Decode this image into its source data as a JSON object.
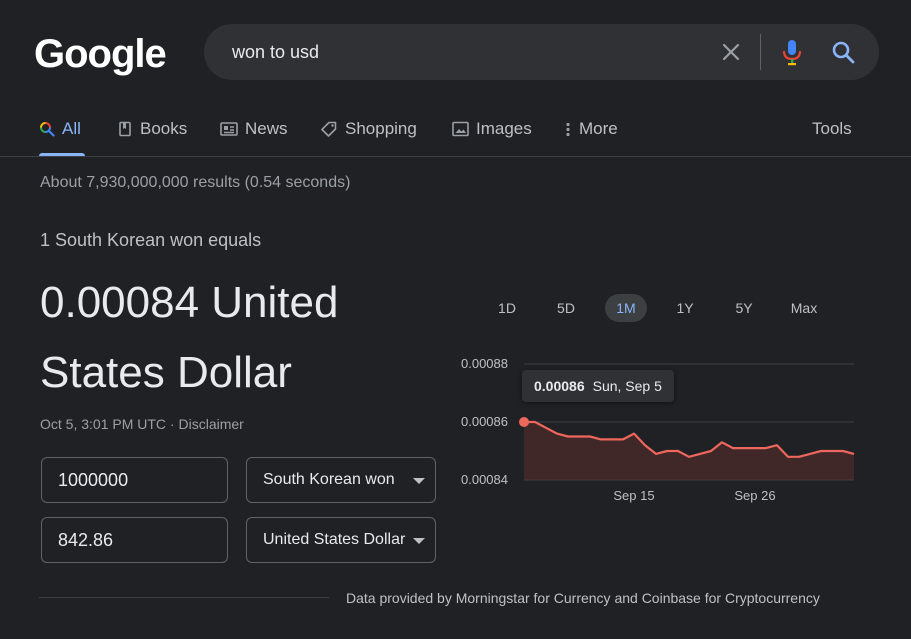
{
  "header": {
    "logo_text": "Google",
    "search": {
      "value": "won to usd",
      "clear_icon": "close-icon",
      "mic_icon": "microphone-icon",
      "search_icon": "search-icon"
    }
  },
  "tabs": [
    {
      "label": "All",
      "icon": "search-multicolor-icon",
      "active": true
    },
    {
      "label": "Books",
      "icon": "book-icon",
      "active": false
    },
    {
      "label": "News",
      "icon": "newspaper-icon",
      "active": false
    },
    {
      "label": "Shopping",
      "icon": "tag-icon",
      "active": false
    },
    {
      "label": "Images",
      "icon": "image-icon",
      "active": false
    },
    {
      "label": "More",
      "icon": "more-vert-icon",
      "active": false
    }
  ],
  "tools_label": "Tools",
  "result_stats": "About 7,930,000,000 results (0.54 seconds)",
  "converter": {
    "equals_label": "1 South Korean won equals",
    "result_value": "0.00084 United States Dollar",
    "timestamp": "Oct 5, 3:01 PM UTC",
    "separator": " · ",
    "disclaimer": "Disclaimer",
    "from_amount": "1000000",
    "from_currency": "South Korean won",
    "to_amount": "842.86",
    "to_currency": "United States Dollar"
  },
  "chart_controls": {
    "ranges": [
      "1D",
      "5D",
      "1M",
      "1Y",
      "5Y",
      "Max"
    ],
    "active": "1M"
  },
  "tooltip": {
    "value": "0.00086",
    "date": "Sun, Sep 5"
  },
  "chart_data": {
    "type": "area",
    "x": [
      "Sep 5",
      "Sep 6",
      "Sep 7",
      "Sep 8",
      "Sep 9",
      "Sep 10",
      "Sep 11",
      "Sep 12",
      "Sep 13",
      "Sep 14",
      "Sep 15",
      "Sep 16",
      "Sep 17",
      "Sep 18",
      "Sep 19",
      "Sep 20",
      "Sep 21",
      "Sep 22",
      "Sep 23",
      "Sep 24",
      "Sep 25",
      "Sep 26",
      "Sep 27",
      "Sep 28",
      "Sep 29",
      "Sep 30",
      "Oct 1",
      "Oct 2",
      "Oct 3",
      "Oct 4",
      "Oct 5"
    ],
    "values": [
      0.00086,
      0.00086,
      0.000858,
      0.000856,
      0.000855,
      0.000855,
      0.000855,
      0.000854,
      0.000854,
      0.000854,
      0.000856,
      0.000852,
      0.000849,
      0.00085,
      0.00085,
      0.000848,
      0.000849,
      0.00085,
      0.000853,
      0.000851,
      0.000851,
      0.000851,
      0.000851,
      0.000852,
      0.000848,
      0.000848,
      0.000849,
      0.00085,
      0.00085,
      0.00085,
      0.000849
    ],
    "x_ticks": [
      "Sep 15",
      "Sep 26"
    ],
    "y_ticks": [
      "0.00088",
      "0.00086",
      "0.00084"
    ],
    "ylim": [
      0.00084,
      0.00088
    ],
    "colors": {
      "line": "#ee675c",
      "fill": "#5c2f2c",
      "grid": "#3c4043"
    }
  },
  "footer": {
    "text": "Data provided by Morningstar for Currency and Coinbase for Cryptocurrency"
  }
}
